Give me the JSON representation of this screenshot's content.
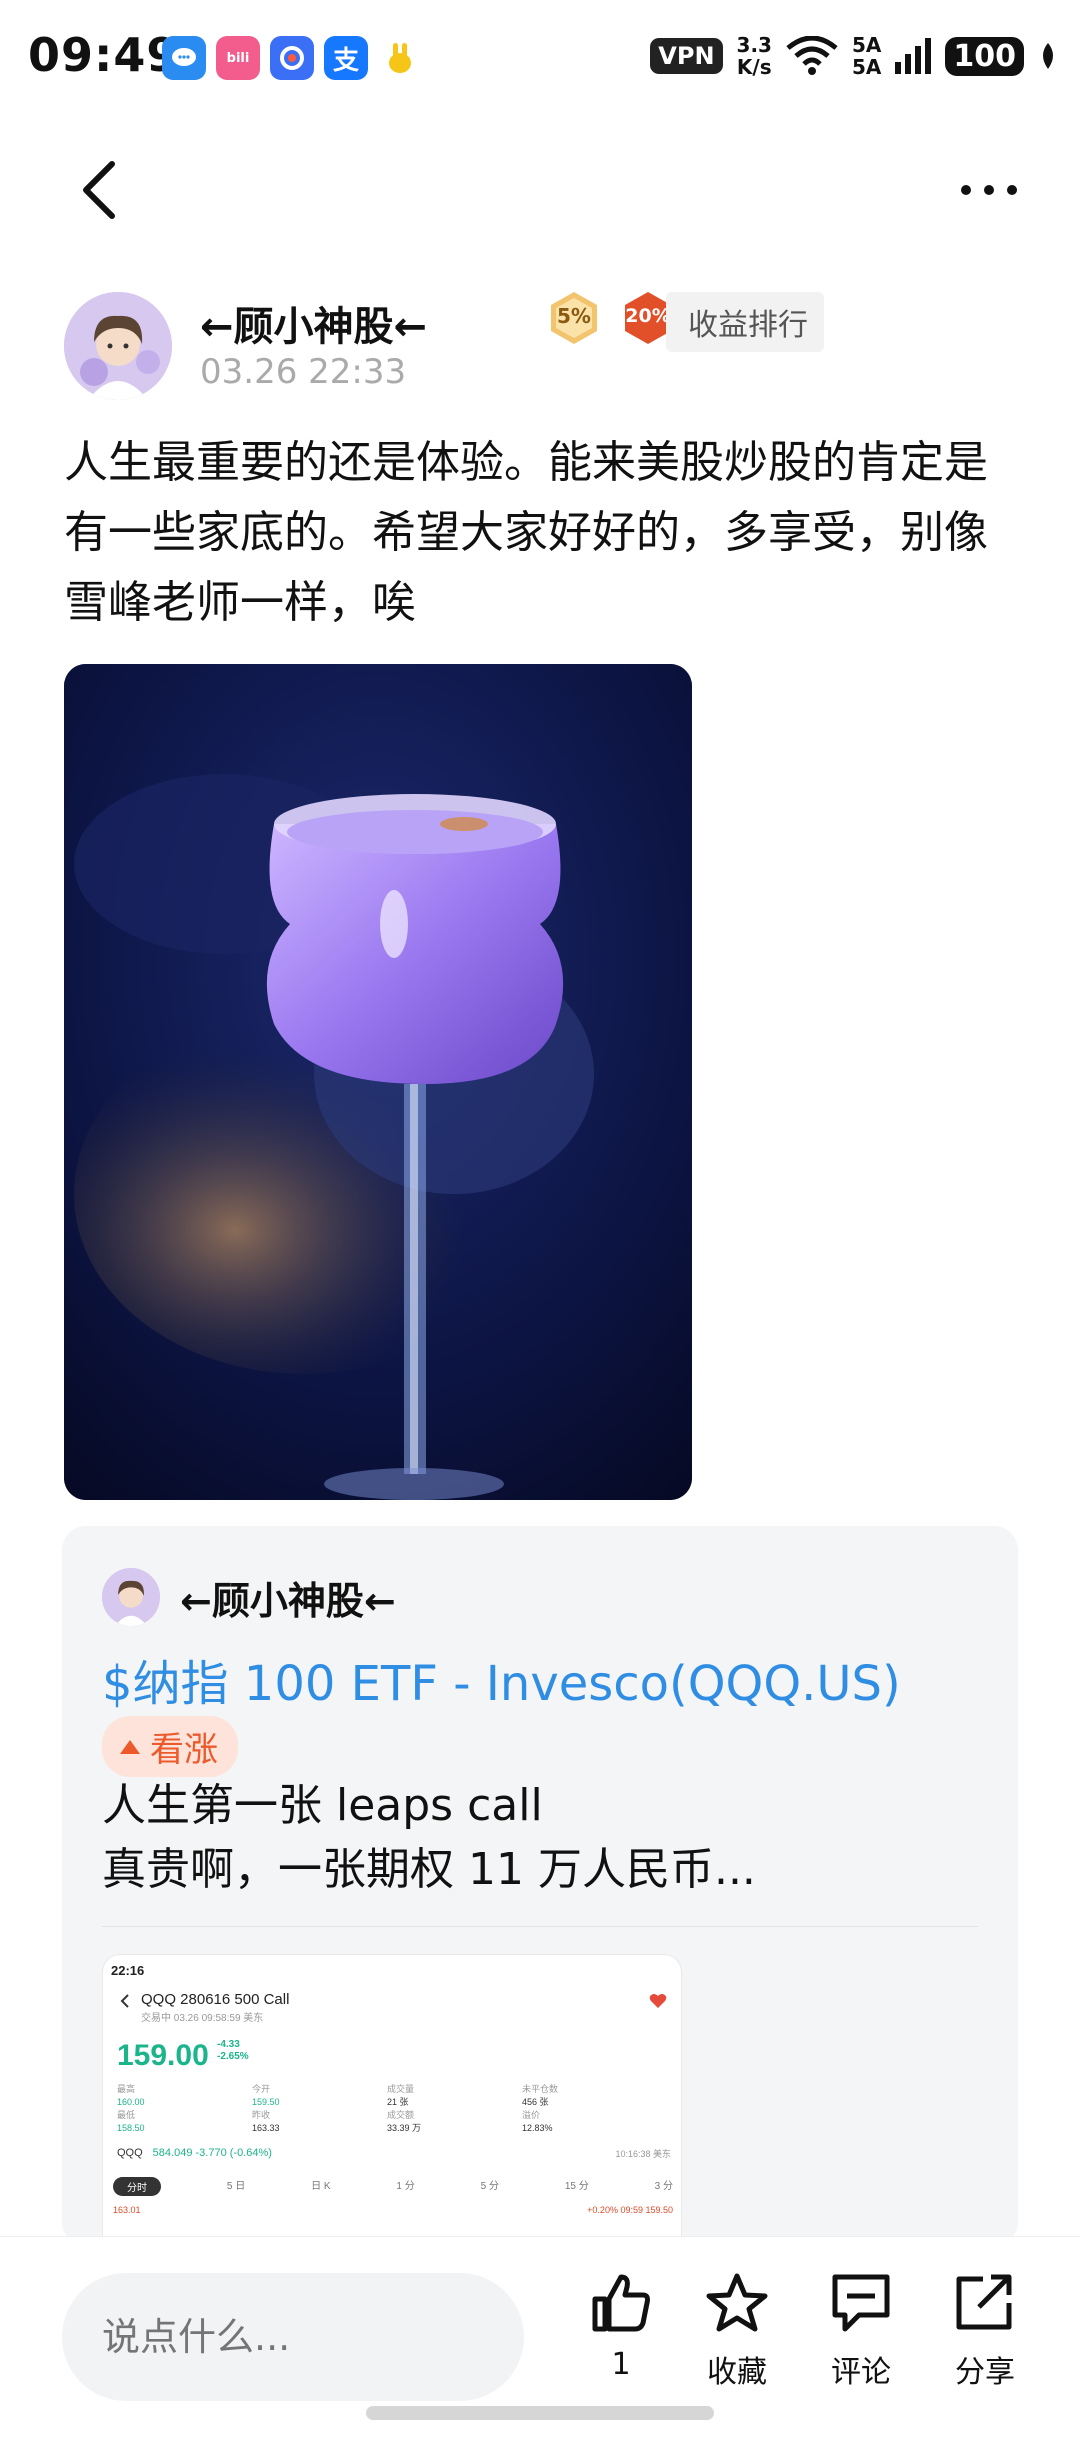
{
  "status_bar": {
    "time": "09:49",
    "vpn": "VPN",
    "net_speed_value": "3.3",
    "net_speed_unit": "K/s",
    "sim1": "5A",
    "sim2": "5A",
    "battery": "100",
    "notif_icons": [
      "chat-app-icon",
      "bilibili-icon",
      "browser-icon",
      "alipay-icon",
      "app-icon"
    ]
  },
  "nav": {
    "back_icon": "chevron-left-icon",
    "more_icon": "more-dots-icon"
  },
  "post": {
    "author": "←顾小神股←",
    "level_badge": "5%",
    "rank_badge": "20%",
    "rank_label": "收益排行",
    "time": "03.26 22:33",
    "text": "人生最重要的还是体验。能来美股炒股的肯定是有一些家底的。希望大家好好的，多享受，别像雪峰老师一样，唉"
  },
  "quoted": {
    "author": "←顾小神股←",
    "stock": "$纳指 100 ETF - Invesco(QQQ.US)",
    "tag": "看涨",
    "line1": "人生第一张 leaps call",
    "line2": "真贵啊，一张期权 11 万人民币...",
    "screenshot": {
      "status_time": "22:16",
      "title": "QQQ 280616 500 Call",
      "subtitle": "交易中 03.26 09:58:59 美东",
      "price": "159.00",
      "change": "-4.33",
      "change_pct": "-2.65%",
      "stats": [
        {
          "k": "最高",
          "v": "160.00",
          "k2": "最低",
          "v2": "158.50"
        },
        {
          "k": "今开",
          "v": "159.50",
          "k2": "昨收",
          "v2": "163.33"
        },
        {
          "k": "成交量",
          "v": "21 张",
          "k2": "成交额",
          "v2": "33.39 万"
        },
        {
          "k": "未平仓数",
          "v": "456 张",
          "k2": "溢价",
          "v2": "12.83%"
        }
      ],
      "qqq_label": "QQQ",
      "qqq_value": "584.049 -3.770 (-0.64%)",
      "qqq_time": "10:16:38 美东",
      "tabs": [
        "分时",
        "5 日",
        "日 K",
        "1 分",
        "5 分",
        "15 分",
        "3 分"
      ],
      "row2_left": "163.01",
      "row2_right": "+0.20%  09:59  159.50"
    }
  },
  "bottom": {
    "comment_placeholder": "说点什么...",
    "like_count": "1",
    "fav_label": "收藏",
    "comment_label": "评论",
    "share_label": "分享"
  }
}
